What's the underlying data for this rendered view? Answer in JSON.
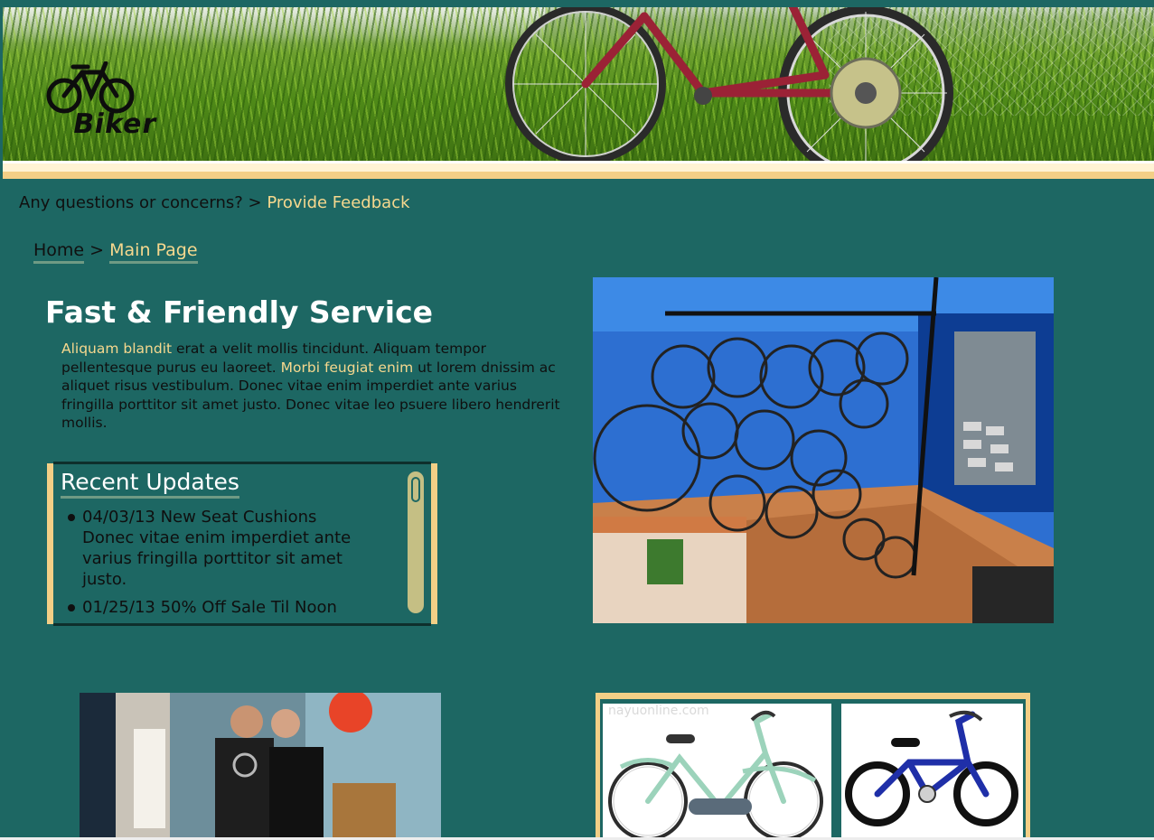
{
  "site": {
    "logo_text": "Biker"
  },
  "feedback": {
    "prompt": "Any questions or concerns? >",
    "link": "Provide Feedback"
  },
  "breadcrumb": {
    "home": "Home",
    "separator": ">",
    "current": "Main Page"
  },
  "service": {
    "title": "Fast & Friendly Service",
    "highlight_1": "Aliquam blandit",
    "text_1": " erat a velit mollis tincidunt. Aliquam tempor pellentesque purus eu laoreet. ",
    "highlight_2": "Morbi feugiat enim",
    "text_2": " ut lorem dnissim ac aliquet risus vestibulum. Donec vitae enim imperdiet ante varius fringilla porttitor sit amet justo. Donec vitae leo psuere libero hendrerit mollis."
  },
  "updates": {
    "title": "Recent Updates",
    "items": [
      {
        "text": "04/03/13 New Seat Cushions Donec vitae enim imperdiet ante varius fringilla porttitor sit amet justo."
      },
      {
        "text": "01/25/13 50% Off Sale Til Noon"
      }
    ]
  },
  "watermark": "nayuonline.com",
  "colors": {
    "background": "#1d6763",
    "accent": "#f3cf86",
    "link": "#f6d88e"
  }
}
